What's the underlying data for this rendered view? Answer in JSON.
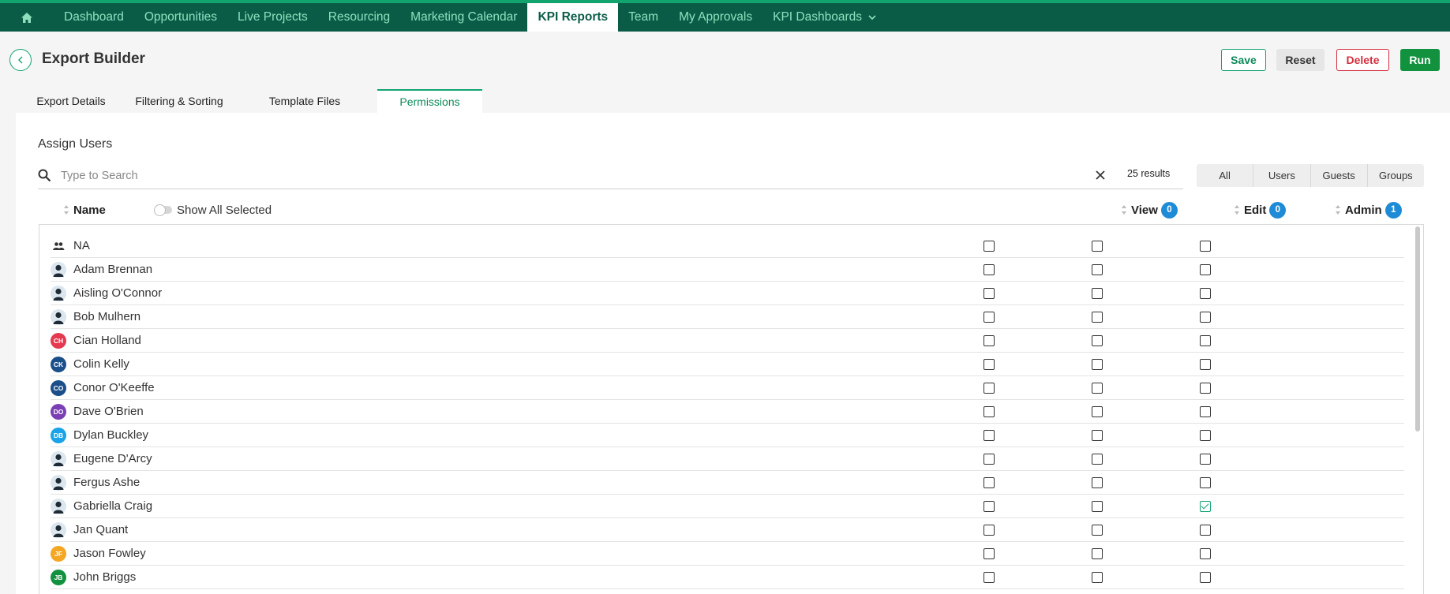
{
  "nav": {
    "items": [
      {
        "label": "Dashboard",
        "active": false
      },
      {
        "label": "Opportunities",
        "active": false
      },
      {
        "label": "Live Projects",
        "active": false
      },
      {
        "label": "Resourcing",
        "active": false
      },
      {
        "label": "Marketing Calendar",
        "active": false
      },
      {
        "label": "KPI Reports",
        "active": true
      },
      {
        "label": "Team",
        "active": false
      },
      {
        "label": "My Approvals",
        "active": false
      },
      {
        "label": "KPI Dashboards",
        "active": false
      }
    ]
  },
  "header": {
    "title": "Export Builder",
    "save_label": "Save",
    "reset_label": "Reset",
    "delete_label": "Delete",
    "run_label": "Run"
  },
  "tabs": [
    {
      "label": "Export Details"
    },
    {
      "label": "Filtering & Sorting"
    },
    {
      "label": "Template Files"
    },
    {
      "label": "Permissions"
    }
  ],
  "assign": {
    "title": "Assign Users",
    "search_placeholder": "Type to Search",
    "results": "25 results",
    "filters": [
      "All",
      "Users",
      "Guests",
      "Groups"
    ],
    "show_all_label": "Show All Selected"
  },
  "columns": {
    "name": "Name",
    "view": "View",
    "view_count": "0",
    "edit": "Edit",
    "edit_count": "0",
    "admin": "Admin",
    "admin_count": "1"
  },
  "rows": [
    {
      "name": "NA",
      "avatar": "group",
      "view": false,
      "edit": false,
      "admin": false
    },
    {
      "name": "Adam Brennan",
      "avatar": "silhouette",
      "view": false,
      "edit": false,
      "admin": false
    },
    {
      "name": "Aisling O'Connor",
      "avatar": "silhouette",
      "view": false,
      "edit": false,
      "admin": false
    },
    {
      "name": "Bob Mulhern",
      "avatar": "silhouette",
      "view": false,
      "edit": false,
      "admin": false
    },
    {
      "name": "Cian Holland",
      "avatar": "initials",
      "initials": "CH",
      "color": "#e53950",
      "view": false,
      "edit": false,
      "admin": false
    },
    {
      "name": "Colin Kelly",
      "avatar": "initials",
      "initials": "CK",
      "color": "#1b4f8a",
      "view": false,
      "edit": false,
      "admin": false
    },
    {
      "name": "Conor O'Keeffe",
      "avatar": "initials",
      "initials": "CO",
      "color": "#1b4f8a",
      "view": false,
      "edit": false,
      "admin": false
    },
    {
      "name": "Dave O'Brien",
      "avatar": "initials",
      "initials": "DO",
      "color": "#7b3fb5",
      "view": false,
      "edit": false,
      "admin": false
    },
    {
      "name": "Dylan Buckley",
      "avatar": "initials",
      "initials": "DB",
      "color": "#1aa3e8",
      "view": false,
      "edit": false,
      "admin": false
    },
    {
      "name": "Eugene D'Arcy",
      "avatar": "silhouette",
      "view": false,
      "edit": false,
      "admin": false
    },
    {
      "name": "Fergus Ashe",
      "avatar": "silhouette",
      "view": false,
      "edit": false,
      "admin": false
    },
    {
      "name": "Gabriella Craig",
      "avatar": "silhouette",
      "view": false,
      "edit": false,
      "admin": true
    },
    {
      "name": "Jan Quant",
      "avatar": "silhouette",
      "view": false,
      "edit": false,
      "admin": false
    },
    {
      "name": "Jason Fowley",
      "avatar": "initials",
      "initials": "JF",
      "color": "#f5a623",
      "view": false,
      "edit": false,
      "admin": false
    },
    {
      "name": "John Briggs",
      "avatar": "initials",
      "initials": "JB",
      "color": "#12923f",
      "view": false,
      "edit": false,
      "admin": false
    }
  ]
}
